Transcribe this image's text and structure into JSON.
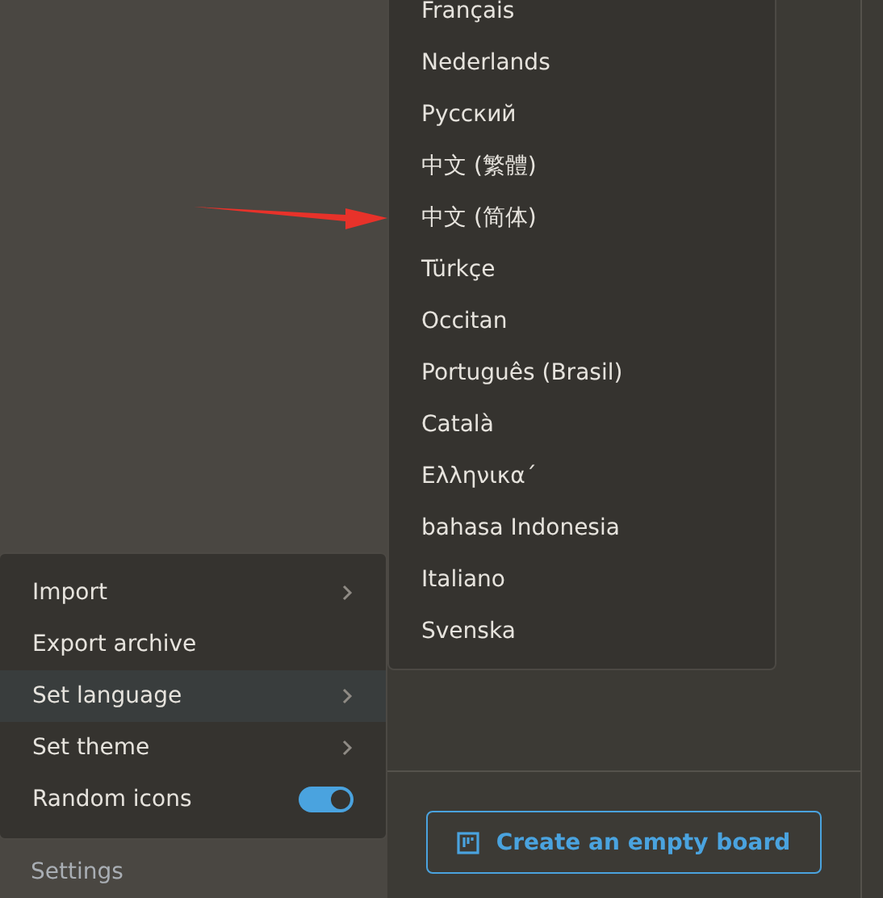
{
  "settings_menu": {
    "items": [
      {
        "label": "Import",
        "kind": "submenu",
        "selected": false
      },
      {
        "label": "Export archive",
        "kind": "action",
        "selected": false
      },
      {
        "label": "Set language",
        "kind": "submenu",
        "selected": true
      },
      {
        "label": "Set theme",
        "kind": "submenu",
        "selected": false
      },
      {
        "label": "Random icons",
        "kind": "toggle",
        "on": true,
        "selected": false
      }
    ]
  },
  "sidebar": {
    "footer_link": "Settings"
  },
  "language_menu": {
    "items": [
      {
        "label": "Français"
      },
      {
        "label": "Nederlands"
      },
      {
        "label": "Русский"
      },
      {
        "label": "中文 (繁體)"
      },
      {
        "label": "中文 (简体)"
      },
      {
        "label": "Türkçe"
      },
      {
        "label": "Occitan"
      },
      {
        "label": "Português (Brasil)"
      },
      {
        "label": "Català"
      },
      {
        "label": "Ελληνικα´"
      },
      {
        "label": "bahasa Indonesia"
      },
      {
        "label": "Italiano"
      },
      {
        "label": "Svenska"
      }
    ]
  },
  "annotation": {
    "kind": "arrow"
  },
  "main": {
    "create_button": "Create an empty board"
  }
}
